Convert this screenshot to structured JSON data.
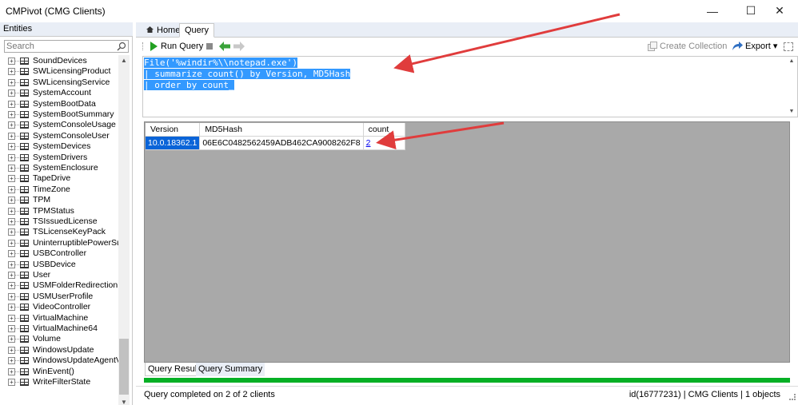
{
  "window": {
    "title": "CMPivot (CMG Clients)",
    "minimize": "—",
    "maximize": "☐",
    "close": "✕"
  },
  "left_pane": {
    "header": "Entities",
    "search_placeholder": "Search",
    "items": [
      "SoundDevices",
      "SWLicensingProduct",
      "SWLicensingService",
      "SystemAccount",
      "SystemBootData",
      "SystemBootSummary",
      "SystemConsoleUsage",
      "SystemConsoleUser",
      "SystemDevices",
      "SystemDrivers",
      "SystemEnclosure",
      "TapeDrive",
      "TimeZone",
      "TPM",
      "TPMStatus",
      "TSIssuedLicense",
      "TSLicenseKeyPack",
      "UninterruptiblePowerSupply",
      "USBController",
      "USBDevice",
      "User",
      "USMFolderRedirectionHea",
      "USMUserProfile",
      "VideoController",
      "VirtualMachine",
      "VirtualMachine64",
      "Volume",
      "WindowsUpdate",
      "WindowsUpdateAgentVers",
      "WinEvent()",
      "WriteFilterState"
    ]
  },
  "tabs": {
    "home": "Home",
    "query": "Query"
  },
  "toolbar": {
    "run_query": "Run Query",
    "create_collection": "Create Collection",
    "export": "Export ▾"
  },
  "editor": {
    "lines": [
      "File('%windir%\\\\notepad.exe')",
      "| summarize count() by Version, MD5Hash",
      "| order by count_"
    ]
  },
  "results": {
    "columns": [
      "Version",
      "MD5Hash",
      "count_"
    ],
    "rows": [
      [
        "10.0.18362.1",
        "06E6C0482562459ADB462CA9008262F8",
        "2"
      ]
    ]
  },
  "result_tabs": {
    "results": "Query Results",
    "summary": "Query Summary"
  },
  "progress": {
    "value": 1.0,
    "color": "#06b025"
  },
  "status": {
    "left": "Query completed on 2 of 2 clients",
    "right": "id(16777231)  |  CMG Clients  |  1 objects"
  },
  "colors": {
    "selection": "#3399ff",
    "annotation_arrow": "#e03c3c"
  }
}
